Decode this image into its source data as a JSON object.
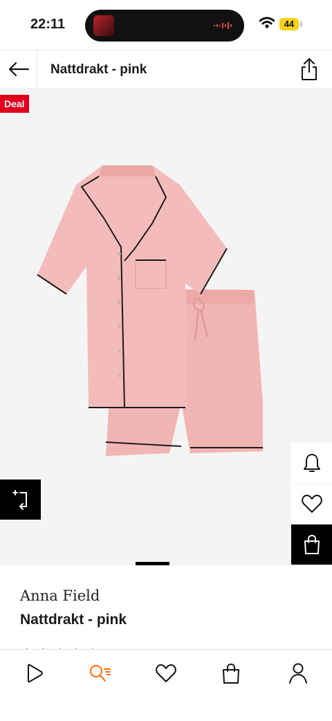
{
  "status_bar": {
    "time": "22:11",
    "battery": "44"
  },
  "header": {
    "title": "Nattdrakt - pink"
  },
  "gallery": {
    "badge": "Deal"
  },
  "product": {
    "brand": "Anna Field",
    "name": "Nattdrakt - pink"
  },
  "colors": {
    "deal": "#e0001b",
    "accent": "#ff6900",
    "garment": "#f2b8b6",
    "piping": "#1b1b1b"
  },
  "icons": {
    "back": "arrow-left-icon",
    "share": "share-icon",
    "bell": "bell-icon",
    "heart": "heart-icon",
    "bag": "shopping-bag-icon",
    "compare": "compare-icon",
    "nav": [
      "play-icon",
      "search-icon",
      "heart-icon",
      "bag-icon",
      "user-icon"
    ]
  }
}
